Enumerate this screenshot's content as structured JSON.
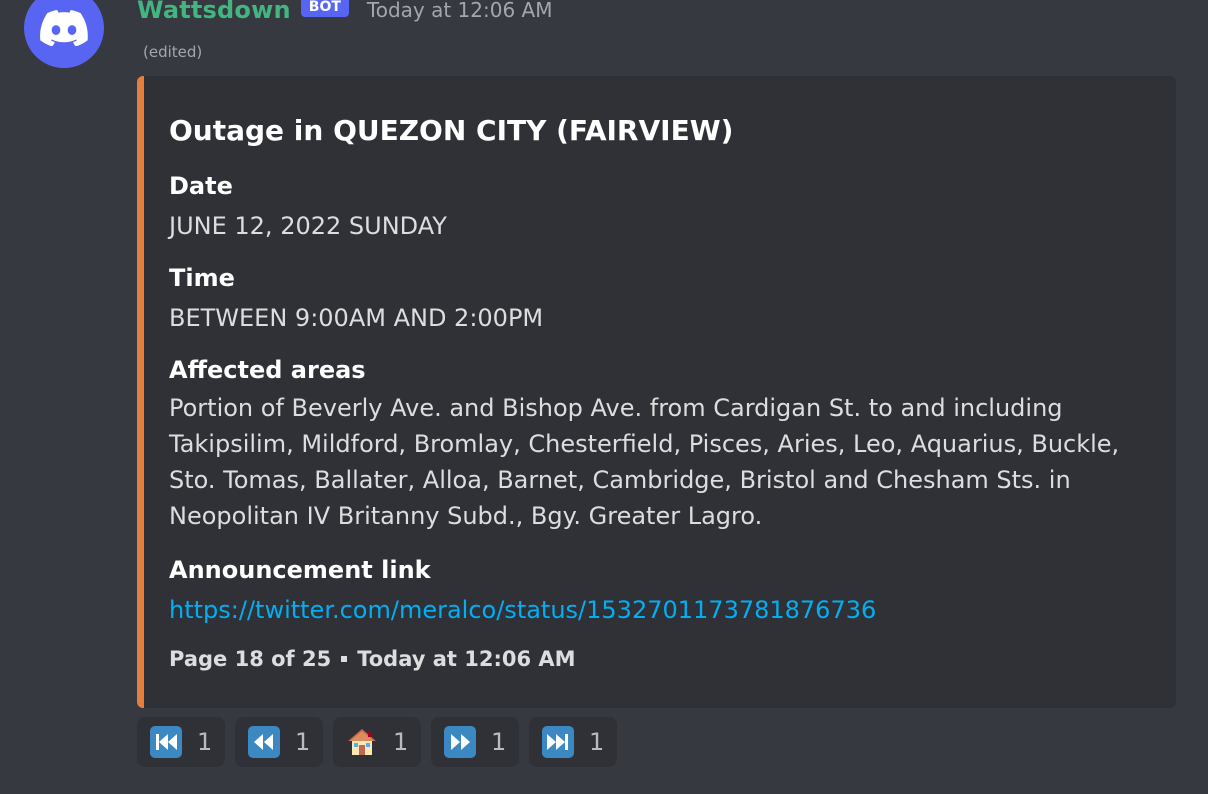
{
  "message": {
    "author": "Wattsdown",
    "bot_tag": "BOT",
    "timestamp": "Today at 12:06 AM",
    "edited_label": "(edited)"
  },
  "embed": {
    "accent_color": "#e67e3c",
    "title": "Outage in QUEZON CITY (FAIRVIEW)",
    "fields": [
      {
        "name": "Date",
        "value": "JUNE 12, 2022 SUNDAY"
      },
      {
        "name": "Time",
        "value": "BETWEEN 9:00AM AND 2:00PM"
      },
      {
        "name": "Affected areas",
        "value": "Portion of Beverly Ave. and Bishop Ave. from Cardigan St. to and including Takipsilim, Mildford, Bromlay, Chesterfield, Pisces, Aries, Leo, Aquarius, Buckle, Sto. Tomas, Ballater, Alloa, Barnet, Cambridge, Bristol and Chesham Sts. in Neopolitan IV Britanny Subd., Bgy. Greater Lagro."
      },
      {
        "name": "Announcement link",
        "value": "https://twitter.com/meralco/status/1532701173781876736"
      }
    ],
    "footer": {
      "page": "Page 18 of 25",
      "timestamp": "Today at 12:06 AM"
    }
  },
  "reactions": [
    {
      "icon": "first-page-icon",
      "count": "1"
    },
    {
      "icon": "previous-page-icon",
      "count": "1"
    },
    {
      "icon": "home-icon",
      "count": "1"
    },
    {
      "icon": "next-page-icon",
      "count": "1"
    },
    {
      "icon": "last-page-icon",
      "count": "1"
    }
  ],
  "colors": {
    "background": "#36393f",
    "embed_background": "#2f3136",
    "username": "#43b581",
    "bot_tag": "#5865f2",
    "link": "#00aff4",
    "avatar": "#5865f2"
  }
}
